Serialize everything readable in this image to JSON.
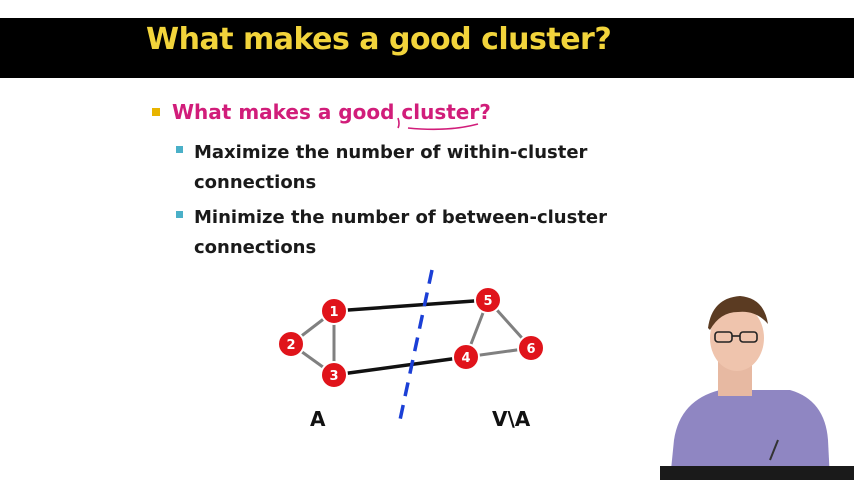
{
  "slide": {
    "title": "What makes a good cluster?",
    "bullet_main": "What makes a good cluster?",
    "sub_bullets": [
      "Maximize the number of within-cluster connections",
      "Minimize the number of between-cluster connections"
    ]
  },
  "graph": {
    "nodes": [
      "1",
      "2",
      "3",
      "4",
      "5",
      "6"
    ],
    "set_a_label": "A",
    "set_va_label": "V\\A"
  },
  "colors": {
    "title_bar": "#000000",
    "title_text": "#f2d43b",
    "main_bullet": "#d11d7a",
    "node_fill": "#e0141b"
  }
}
